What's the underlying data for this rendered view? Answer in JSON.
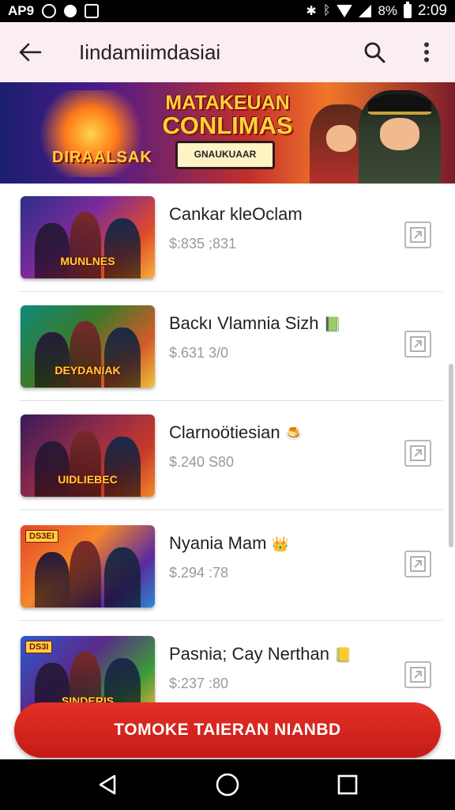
{
  "status_bar": {
    "app_label": "AP9",
    "battery_percent": "8%",
    "time": "2:09"
  },
  "app_bar": {
    "title": "Iindamiimdasiai",
    "icons": [
      "back-arrow-icon",
      "search-icon",
      "more-vert-icon"
    ]
  },
  "banner": {
    "headline_line1": "MATAKEUAN",
    "headline_line2": "CONLIMAS",
    "subtitle": "GNAUKUAAR",
    "left_word": "DIRAALSAK"
  },
  "items": [
    {
      "name": "Cankar kleOclam",
      "price": "$:835 ;831",
      "emoji": "",
      "thumb_label": "MUNLNES",
      "thumb_tag": "",
      "thumb_colors": [
        "#2a2f8a",
        "#7b2a9a",
        "#e04a2a",
        "#f6b23a"
      ]
    },
    {
      "name": "Backı Vlamnia Sizh",
      "price": "$.631 3/0",
      "emoji": "📗",
      "thumb_label": "DEYDANIAK",
      "thumb_tag": "",
      "thumb_colors": [
        "#0f8a7a",
        "#3a7a2a",
        "#d25a2a",
        "#f1c23a"
      ]
    },
    {
      "name": "Clarnoötiesian",
      "price": "$.240 S80",
      "emoji": "🍮",
      "thumb_label": "UIDLIEBEC",
      "thumb_tag": "",
      "thumb_colors": [
        "#3a1a5a",
        "#8a2a4a",
        "#c83a2a",
        "#f28a2a"
      ]
    },
    {
      "name": "Nyania Mam",
      "price": "$.294 :78",
      "emoji": "👑",
      "thumb_label": "",
      "thumb_tag": "DS3EI",
      "thumb_colors": [
        "#e6452a",
        "#f5862a",
        "#5a2aa0",
        "#2a8ad0"
      ]
    },
    {
      "name": "Pasnia; Cay Nerthan",
      "price": "$:237 :80",
      "emoji": "📒",
      "thumb_label": "SINDERIS",
      "thumb_tag": "DS3I",
      "thumb_colors": [
        "#2a5ad0",
        "#5a2a8a",
        "#3a9a3a",
        "#f5b23a"
      ]
    }
  ],
  "cta": {
    "label": "TOMOKE TAIERAN NIANBD"
  },
  "nav_bar": {
    "icons": [
      "back-triangle-icon",
      "home-circle-icon",
      "recents-square-icon"
    ]
  }
}
